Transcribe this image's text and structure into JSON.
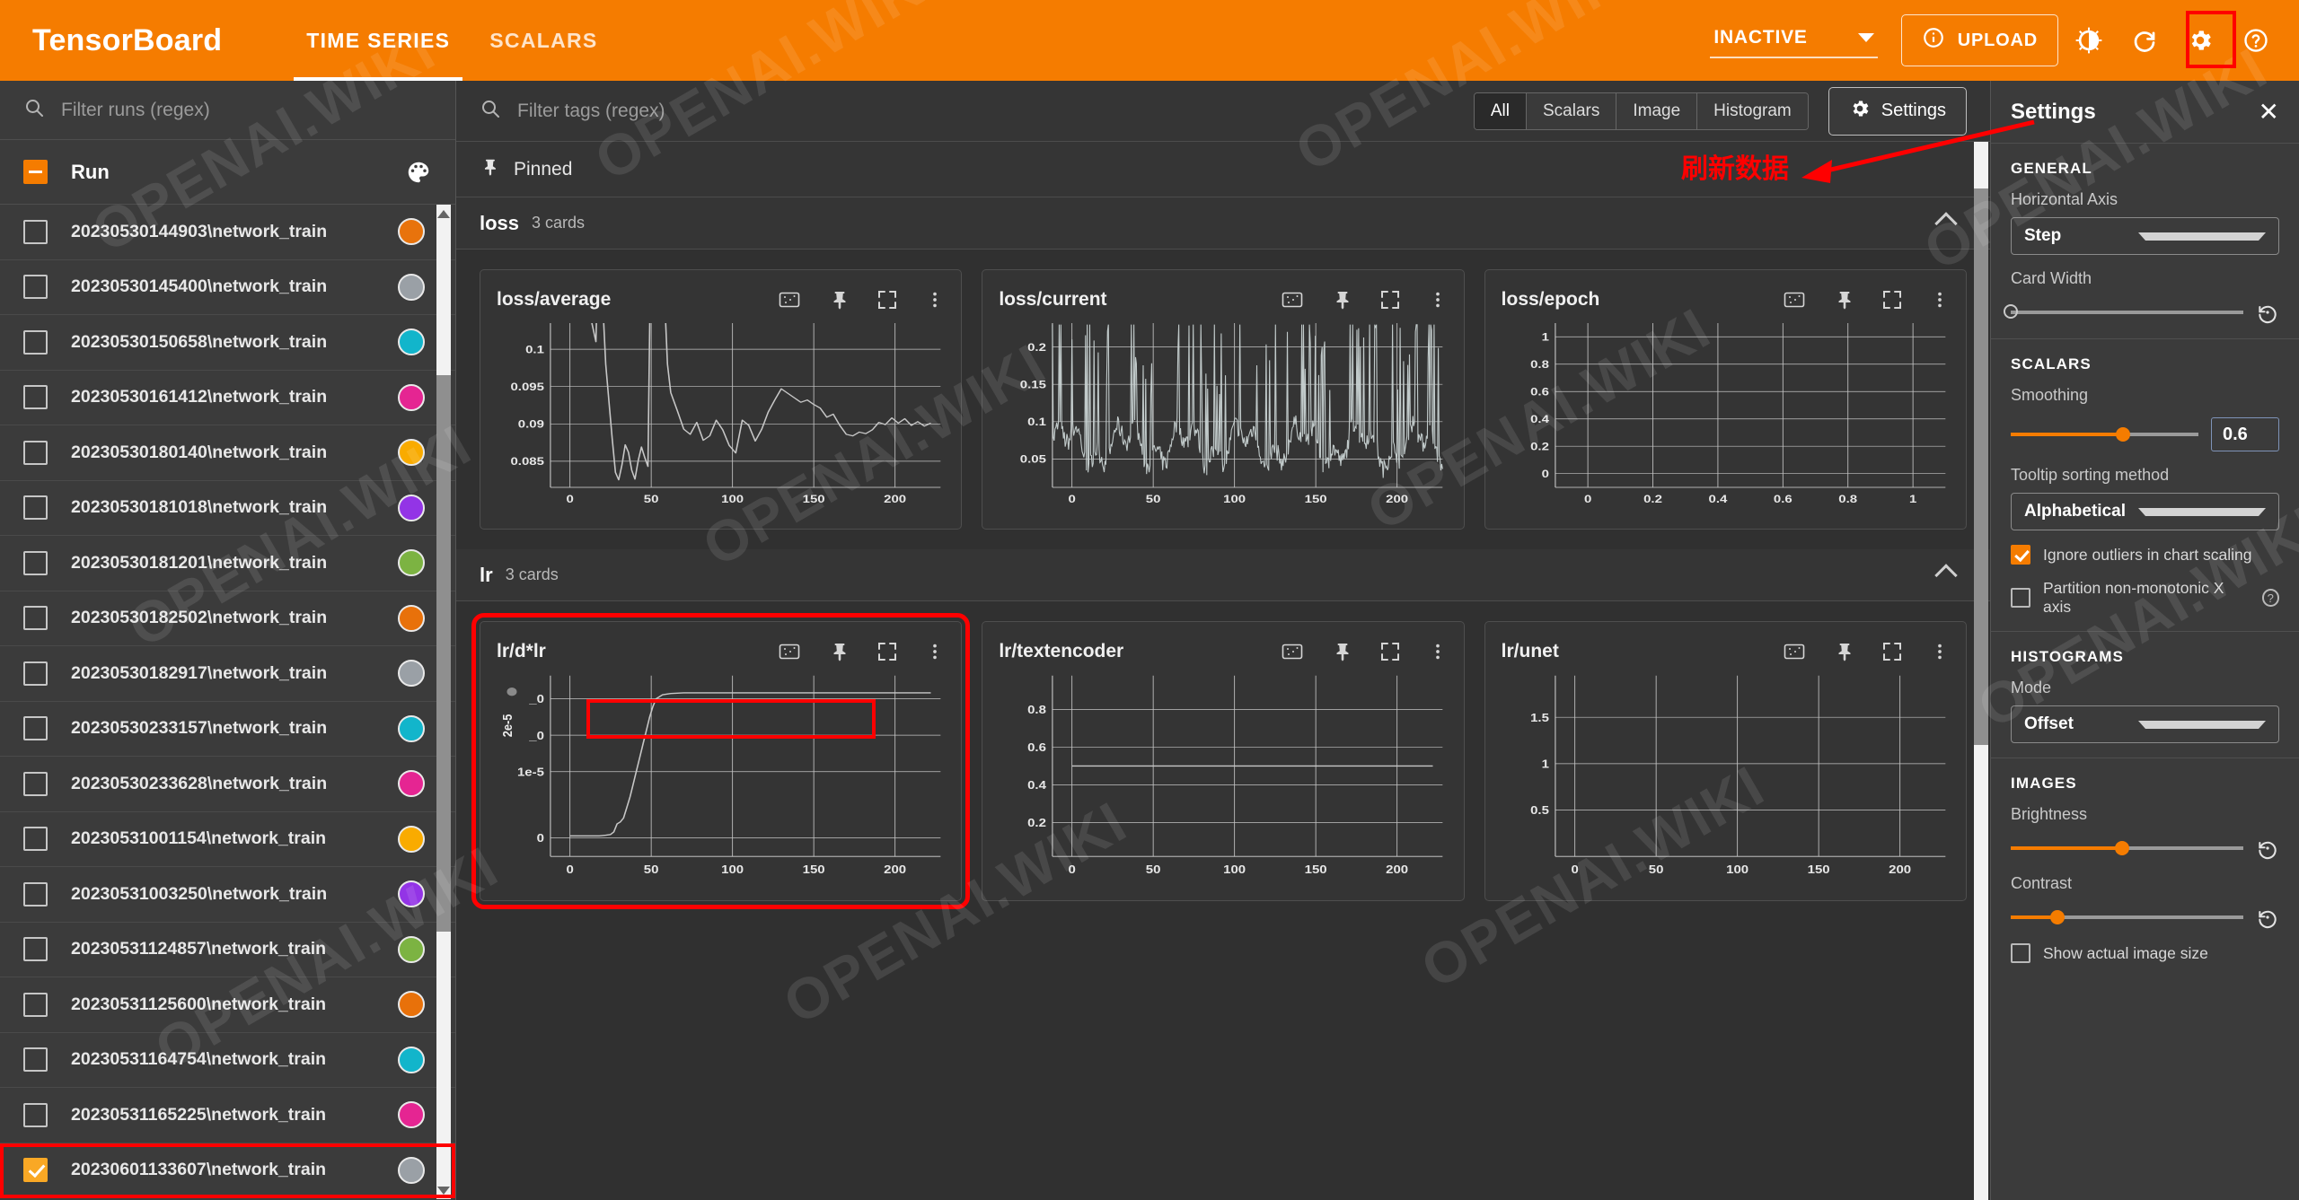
{
  "topbar": {
    "brand": "TensorBoard",
    "tabs": [
      {
        "label": "TIME SERIES",
        "active": true
      },
      {
        "label": "SCALARS",
        "active": false
      }
    ],
    "status_select": "INACTIVE",
    "upload_label": "UPLOAD",
    "icons": [
      "info-icon",
      "brightness-icon",
      "refresh-icon",
      "gear-icon",
      "help-icon"
    ],
    "accent_color": "#f57c00"
  },
  "sidebar": {
    "filter_placeholder": "Filter runs (regex)",
    "filter_value": "",
    "run_header_label": "Run",
    "runs": [
      {
        "name": "20230530144903\\network_train",
        "color": "#e8730c",
        "checked": false
      },
      {
        "name": "20230530145400\\network_train",
        "color": "#9aa0a6",
        "checked": false
      },
      {
        "name": "20230530150658\\network_train",
        "color": "#12b5cb",
        "checked": false
      },
      {
        "name": "20230530161412\\network_train",
        "color": "#e52592",
        "checked": false
      },
      {
        "name": "20230530180140\\network_train",
        "color": "#f9ab00",
        "checked": false
      },
      {
        "name": "20230530181018\\network_train",
        "color": "#9334e6",
        "checked": false
      },
      {
        "name": "20230530181201\\network_train",
        "color": "#7cb342",
        "checked": false
      },
      {
        "name": "20230530182502\\network_train",
        "color": "#e8710a",
        "checked": false
      },
      {
        "name": "20230530182917\\network_train",
        "color": "#9aa0a6",
        "checked": false
      },
      {
        "name": "20230530233157\\network_train",
        "color": "#12b5cb",
        "checked": false
      },
      {
        "name": "20230530233628\\network_train",
        "color": "#e52592",
        "checked": false
      },
      {
        "name": "20230531001154\\network_train",
        "color": "#f9ab00",
        "checked": false
      },
      {
        "name": "20230531003250\\network_train",
        "color": "#9334e6",
        "checked": false
      },
      {
        "name": "20230531124857\\network_train",
        "color": "#7cb342",
        "checked": false
      },
      {
        "name": "20230531125600\\network_train",
        "color": "#e8710a",
        "checked": false
      },
      {
        "name": "20230531164754\\network_train",
        "color": "#12b5cb",
        "checked": false
      },
      {
        "name": "20230531165225\\network_train",
        "color": "#e52592",
        "checked": false
      },
      {
        "name": "20230601133607\\network_train",
        "color": "#9aa0a6",
        "checked": true
      }
    ]
  },
  "main": {
    "tag_filter_placeholder": "Filter tags (regex)",
    "tag_filter_value": "",
    "filter_chips": [
      {
        "label": "All",
        "active": true
      },
      {
        "label": "Scalars",
        "active": false
      },
      {
        "label": "Image",
        "active": false
      },
      {
        "label": "Histogram",
        "active": false
      }
    ],
    "settings_button": "Settings",
    "pinned_label": "Pinned",
    "annotation": "刷新数据",
    "sections": [
      {
        "title": "loss",
        "count": "3 cards"
      },
      {
        "title": "lr",
        "count": "3 cards"
      }
    ]
  },
  "chart_data": [
    {
      "type": "line",
      "title": "loss/average",
      "xlabel": "",
      "ylabel": "",
      "xticks": [
        0,
        50,
        100,
        150,
        200
      ],
      "yticks": [
        0.085,
        0.09,
        0.095,
        0.1
      ],
      "xlim": [
        -12,
        228
      ],
      "ylim": [
        0.0815,
        0.1035
      ],
      "grid": true,
      "series": [
        {
          "name": "20230601133607\\network_train",
          "color": "#c7c7c7",
          "x": [
            0,
            4,
            8,
            12,
            16,
            18,
            20,
            22,
            24,
            26,
            28,
            30,
            32,
            34,
            36,
            38,
            40,
            42,
            44,
            46,
            48,
            50,
            52,
            54,
            56,
            58,
            60,
            62,
            66,
            70,
            74,
            78,
            82,
            86,
            90,
            94,
            98,
            102,
            106,
            110,
            114,
            118,
            122,
            126,
            130,
            134,
            138,
            142,
            146,
            150,
            154,
            158,
            162,
            166,
            170,
            174,
            178,
            182,
            186,
            190,
            194,
            198,
            202,
            206,
            210,
            214,
            218,
            222
          ],
          "y": [
            0.118,
            0.115,
            0.112,
            0.105,
            0.101,
            0.12,
            0.107,
            0.098,
            0.093,
            0.088,
            0.0835,
            0.0825,
            0.0845,
            0.0872,
            0.0862,
            0.0838,
            0.0826,
            0.0851,
            0.0869,
            0.0855,
            0.0843,
            0.12,
            0.118,
            0.121,
            0.119,
            0.108,
            0.098,
            0.0942,
            0.0918,
            0.0893,
            0.0886,
            0.0902,
            0.0878,
            0.0884,
            0.0905,
            0.0892,
            0.0871,
            0.0861,
            0.0905,
            0.0898,
            0.0877,
            0.0893,
            0.0916,
            0.0932,
            0.0947,
            0.0941,
            0.0935,
            0.0929,
            0.0932,
            0.0926,
            0.0921,
            0.0909,
            0.0913,
            0.0898,
            0.0886,
            0.0884,
            0.0889,
            0.0887,
            0.0892,
            0.0902,
            0.0899,
            0.0908,
            0.0901,
            0.0907,
            0.0898,
            0.0903,
            0.0897,
            0.0901
          ]
        }
      ]
    },
    {
      "type": "line",
      "title": "loss/current",
      "xlabel": "",
      "ylabel": "",
      "xticks": [
        0,
        50,
        100,
        150,
        200
      ],
      "yticks": [
        0.05,
        0.1,
        0.15,
        0.2
      ],
      "xlim": [
        -12,
        228
      ],
      "ylim": [
        0.012,
        0.232
      ],
      "grid": true,
      "series": [
        {
          "name": "20230601133607\\network_train",
          "color": "#c7c7c7",
          "x": [
            0
          ],
          "y": [
            0.05
          ],
          "note": "dense noisy high-frequency trace oscillating between ~0.015 and ~0.23"
        }
      ]
    },
    {
      "type": "line",
      "title": "loss/epoch",
      "xlabel": "",
      "ylabel": "",
      "xticks": [
        0,
        0.2,
        0.4,
        0.6,
        0.8,
        1
      ],
      "yticks": [
        0,
        0.2,
        0.4,
        0.6,
        0.8,
        1
      ],
      "xlim": [
        -0.1,
        1.1
      ],
      "ylim": [
        -0.1,
        1.1
      ],
      "grid": true,
      "series": []
    },
    {
      "type": "line",
      "title": "lr/d*lr",
      "xlabel": "",
      "ylabel": "2e-5",
      "xticks": [
        0,
        50,
        100,
        150,
        200
      ],
      "yticks": [
        "0",
        "1e-5",
        "_0",
        "_0"
      ],
      "xlim": [
        -12,
        228
      ],
      "ylim": [
        -0.28,
        2.45
      ],
      "grid": true,
      "series": [
        {
          "name": "20230601133607\\network_train",
          "color": "#c7c7c7",
          "x": [
            0,
            10,
            18,
            22,
            25,
            27,
            29,
            31,
            33,
            35,
            37,
            39,
            41,
            43,
            45,
            47,
            49,
            51,
            53,
            57,
            62,
            70,
            90,
            120,
            150,
            180,
            210,
            222
          ],
          "y": [
            0.03,
            0.03,
            0.03,
            0.04,
            0.05,
            0.09,
            0.21,
            0.24,
            0.3,
            0.46,
            0.62,
            0.82,
            1.02,
            1.22,
            1.42,
            1.62,
            1.82,
            1.98,
            2.1,
            2.16,
            2.18,
            2.19,
            2.19,
            2.19,
            2.19,
            2.19,
            2.19,
            2.19
          ]
        }
      ]
    },
    {
      "type": "line",
      "title": "lr/textencoder",
      "xlabel": "",
      "ylabel": "",
      "xticks": [
        0,
        50,
        100,
        150,
        200
      ],
      "yticks": [
        0.2,
        0.4,
        0.6,
        0.8
      ],
      "xlim": [
        -12,
        228
      ],
      "ylim": [
        0.02,
        0.98
      ],
      "grid": true,
      "series": [
        {
          "name": "20230601133607\\network_train",
          "color": "#c7c7c7",
          "x": [
            0,
            222
          ],
          "y": [
            0.5,
            0.5
          ]
        }
      ]
    },
    {
      "type": "line",
      "title": "lr/unet",
      "xlabel": "",
      "ylabel": "",
      "xticks": [
        0,
        50,
        100,
        150,
        200
      ],
      "yticks": [
        0.5,
        1,
        1.5
      ],
      "xlim": [
        -12,
        228
      ],
      "ylim": [
        0.0,
        1.95
      ],
      "grid": true,
      "series": []
    }
  ],
  "card_actions": [
    "data-table-icon",
    "pin-icon",
    "fullscreen-icon",
    "more-vert-icon"
  ],
  "settings": {
    "title": "Settings",
    "sections": {
      "general": {
        "title": "GENERAL",
        "horizontal_axis_label": "Horizontal Axis",
        "horizontal_axis_value": "Step",
        "card_width_label": "Card Width",
        "card_width_pct": 0
      },
      "scalars": {
        "title": "SCALARS",
        "smoothing_label": "Smoothing",
        "smoothing_value": "0.6",
        "smoothing_pct": 60,
        "tooltip_sort_label": "Tooltip sorting method",
        "tooltip_sort_value": "Alphabetical",
        "ignore_outliers_label": "Ignore outliers in chart scaling",
        "ignore_outliers_checked": true,
        "partition_label": "Partition non-monotonic X axis",
        "partition_checked": false
      },
      "histograms": {
        "title": "HISTOGRAMS",
        "mode_label": "Mode",
        "mode_value": "Offset"
      },
      "images": {
        "title": "IMAGES",
        "brightness_label": "Brightness",
        "brightness_pct": 48,
        "contrast_label": "Contrast",
        "contrast_pct": 20,
        "show_actual_label": "Show actual image size",
        "show_actual_checked": false
      }
    }
  },
  "watermark": "OPENAI.WIKI"
}
